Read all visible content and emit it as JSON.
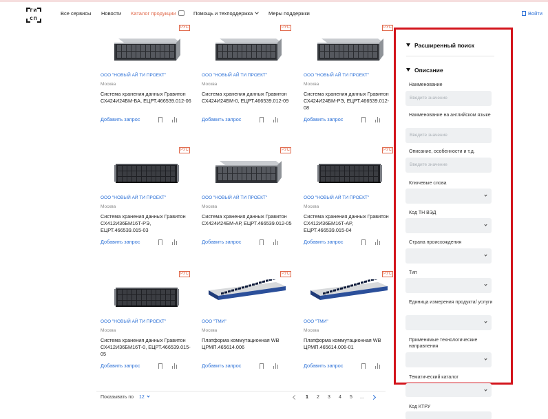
{
  "header": {
    "logo_line1": "ГИ",
    "logo_line2": "СП",
    "nav": [
      {
        "label": "Все сервисы"
      },
      {
        "label": "Новости"
      },
      {
        "label": "Каталог продукции"
      },
      {
        "label": "Помощь и техподдержка"
      },
      {
        "label": "Меры поддержки"
      }
    ],
    "login": "Войти"
  },
  "products": [
    {
      "badge": "РУС",
      "company": "ООО \"НОВЫЙ АЙ ТИ ПРОЕКТ\"",
      "city": "Москва",
      "title": "Система хранения данных Гравитон СХ424И24БМ-БА, ЕЦРТ.466539.012-06",
      "request": "Добавить запрос",
      "image": "server-4u-icon"
    },
    {
      "badge": "РУС",
      "company": "ООО \"НОВЫЙ АЙ ТИ ПРОЕКТ\"",
      "city": "Москва",
      "title": "Система хранения данных Гравитон СХ424И24БМ-0, ЕЦРТ.466539.012-09",
      "request": "Добавить запрос",
      "image": "server-4u-icon"
    },
    {
      "badge": "РУС",
      "company": "ООО \"НОВЫЙ АЙ ТИ ПРОЕКТ\"",
      "city": "Москва",
      "title": "Система хранения данных Гравитон СХ424И24БМ-РЭ, ЕЦРТ.466539.012-08",
      "request": "Добавить запрос",
      "image": "server-4u-icon"
    },
    {
      "badge": "РУС",
      "company": "ООО \"НОВЫЙ АЙ ТИ ПРОЕКТ\"",
      "city": "Москва",
      "title": "Система хранения данных Гравитон СХ412И36БМ16Т-РЭ, ЕЦРТ.466539.015-03",
      "request": "Добавить запрос",
      "image": "server-dark-icon"
    },
    {
      "badge": "РУС",
      "company": "ООО \"НОВЫЙ АЙ ТИ ПРОЕКТ\"",
      "city": "Москва",
      "title": "Система хранения данных Гравитон СХ424И24БМ-АР, ЕЦРТ.466539.012-05",
      "request": "Добавить запрос",
      "image": "server-4u-icon"
    },
    {
      "badge": "РУС",
      "company": "ООО \"НОВЫЙ АЙ ТИ ПРОЕКТ\"",
      "city": "Москва",
      "title": "Система хранения данных Гравитон СХ412И36БМ16Т-АР, ЕЦРТ.466539.015-04",
      "request": "Добавить запрос",
      "image": "server-dark-icon"
    },
    {
      "badge": "РУС",
      "company": "ООО \"НОВЫЙ АЙ ТИ ПРОЕКТ\"",
      "city": "Москва",
      "title": "Система хранения данных Гравитон СХ412И36БМ16Т-0, ЕЦРТ.466539.015-05",
      "request": "Добавить запрос",
      "image": "server-dark-icon"
    },
    {
      "badge": "РУС",
      "company": "ООО \"ТМИ\"",
      "city": "Москва",
      "title": "Платформа коммутационная WB ЦРМП.465614.006",
      "request": "Добавить запрос",
      "image": "network-switch-icon"
    },
    {
      "badge": "РУС",
      "company": "ООО \"ТМИ\"",
      "city": "Москва",
      "title": "Платформа коммутационная WB ЦРМП.465614.006-01",
      "request": "Добавить запрос",
      "image": "network-switch-icon"
    }
  ],
  "pagination": {
    "show_label": "Показывать по",
    "page_size": "12",
    "pages": [
      "1",
      "2",
      "3",
      "4",
      "5",
      "..."
    ],
    "current": "1"
  },
  "sidebar": {
    "advanced_search": "Расширенный поиск",
    "description_section": "Описание",
    "fields": [
      {
        "label": "Наименование",
        "type": "input",
        "placeholder": "Введите значение"
      },
      {
        "label": "Наименование на английском языке",
        "type": "input",
        "placeholder": "Введите значение"
      },
      {
        "label": "Описание, особенности и т.д.",
        "type": "input",
        "placeholder": "Введите значение"
      },
      {
        "label": "Ключевые слова",
        "type": "select"
      },
      {
        "label": "Код ТН ВЭД",
        "type": "select"
      },
      {
        "label": "Страна происхождения",
        "type": "select"
      },
      {
        "label": "Тип",
        "type": "select"
      },
      {
        "label": "Единица измерения продукта/ услуги",
        "type": "select"
      },
      {
        "label": "Применимые технологические направления",
        "type": "select"
      },
      {
        "label": "Тематический каталог",
        "type": "select"
      },
      {
        "label": "Код КТРУ",
        "type": "select"
      }
    ]
  },
  "colors": {
    "accent_blue": "#2a6fd6",
    "accent_orange": "#e0684a",
    "highlight_red": "#d3141c"
  }
}
